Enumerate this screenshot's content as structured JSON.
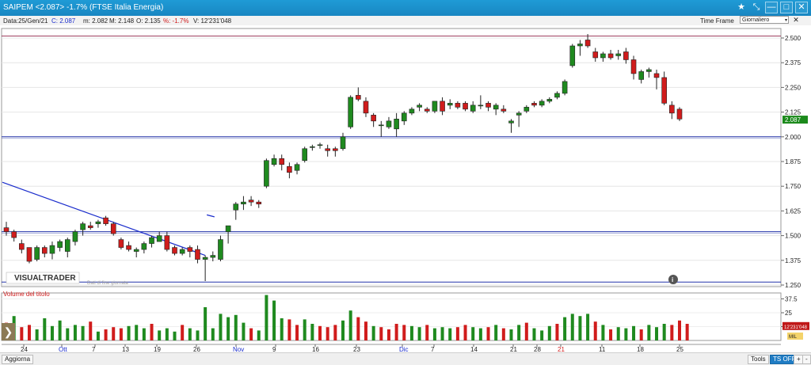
{
  "window": {
    "title": "SAIPEM <2.087> -1.7%  (FTSE Italia Energia)",
    "buttons": [
      "★",
      "⤡",
      "—",
      "□",
      "✕"
    ]
  },
  "info": {
    "data": "Data:25/Gen/21",
    "close": "C: 2.087",
    "min": "m: 2.082",
    "max": "M: 2.148",
    "open": "O: 2.135",
    "pct": "%: -1.7%",
    "vol": "V: 12'231'048",
    "timeframe_label": "Time Frame",
    "timeframe_value": "Giornaliero",
    "timeframe_arrow": "▾",
    "close_x": "✕"
  },
  "logo": {
    "text": "VISUALTRADER",
    "caption": "Dati di fine giornata"
  },
  "volume_title": "Volume del titolo",
  "info_icon": "i",
  "bottom": {
    "left": "Aggiorna",
    "tools": "Tools",
    "tsoff": "TS OFF",
    "plus": "+",
    "minus": "-"
  },
  "side_arrow": "❯",
  "colors": {
    "up": "#1f8a1f",
    "down": "#d01c1c",
    "line": "#1a2ccc",
    "hline": "#2233aa",
    "hline_top": "#a04060"
  },
  "chart_data": [
    {
      "type": "candlestick",
      "ylim": [
        1.25,
        2.5
      ],
      "yticks": [
        "2.500",
        "2.375",
        "2.250",
        "2.125",
        "2.000",
        "1.875",
        "1.750",
        "1.625",
        "1.500",
        "1.375",
        "1.250"
      ],
      "current_label": "2.087",
      "xlabels": [
        "24",
        "Ott",
        "7",
        "13",
        "19",
        "26",
        "Nov",
        "9",
        "16",
        "23",
        "Dic",
        "7",
        "14",
        "21",
        "28",
        "21",
        "11",
        "18",
        "25"
      ],
      "highlight_xlabel": "21",
      "hlines": [
        2.51,
        2.0,
        1.52,
        1.265
      ],
      "ohlc": [
        [
          1.54,
          1.57,
          1.5,
          1.52
        ],
        [
          1.52,
          1.53,
          1.47,
          1.49
        ],
        [
          1.46,
          1.48,
          1.41,
          1.43
        ],
        [
          1.44,
          1.44,
          1.36,
          1.37
        ],
        [
          1.38,
          1.45,
          1.37,
          1.44
        ],
        [
          1.44,
          1.45,
          1.39,
          1.41
        ],
        [
          1.41,
          1.47,
          1.38,
          1.45
        ],
        [
          1.44,
          1.48,
          1.42,
          1.47
        ],
        [
          1.42,
          1.49,
          1.39,
          1.48
        ],
        [
          1.47,
          1.53,
          1.45,
          1.52
        ],
        [
          1.53,
          1.57,
          1.5,
          1.56
        ],
        [
          1.55,
          1.57,
          1.53,
          1.54
        ],
        [
          1.56,
          1.58,
          1.54,
          1.57
        ],
        [
          1.59,
          1.6,
          1.55,
          1.56
        ],
        [
          1.56,
          1.57,
          1.5,
          1.51
        ],
        [
          1.48,
          1.49,
          1.43,
          1.44
        ],
        [
          1.45,
          1.47,
          1.42,
          1.43
        ],
        [
          1.42,
          1.44,
          1.39,
          1.43
        ],
        [
          1.43,
          1.47,
          1.41,
          1.46
        ],
        [
          1.46,
          1.5,
          1.44,
          1.49
        ],
        [
          1.47,
          1.52,
          1.47,
          1.5
        ],
        [
          1.5,
          1.52,
          1.42,
          1.43
        ],
        [
          1.44,
          1.45,
          1.4,
          1.41
        ],
        [
          1.41,
          1.44,
          1.4,
          1.43
        ],
        [
          1.44,
          1.45,
          1.39,
          1.42
        ],
        [
          1.43,
          1.45,
          1.36,
          1.38
        ],
        [
          1.38,
          1.4,
          1.27,
          1.39
        ],
        [
          1.39,
          1.42,
          1.37,
          1.4
        ],
        [
          1.38,
          1.5,
          1.37,
          1.48
        ],
        [
          1.52,
          1.55,
          1.46,
          1.55
        ],
        [
          1.63,
          1.67,
          1.58,
          1.66
        ],
        [
          1.66,
          1.7,
          1.63,
          1.67
        ],
        [
          1.68,
          1.7,
          1.65,
          1.67
        ],
        [
          1.67,
          1.68,
          1.64,
          1.66
        ],
        [
          1.75,
          1.89,
          1.74,
          1.88
        ],
        [
          1.86,
          1.91,
          1.85,
          1.89
        ],
        [
          1.89,
          1.91,
          1.83,
          1.86
        ],
        [
          1.85,
          1.87,
          1.79,
          1.82
        ],
        [
          1.83,
          1.87,
          1.81,
          1.86
        ],
        [
          1.88,
          1.95,
          1.87,
          1.94
        ],
        [
          1.95,
          1.96,
          1.93,
          1.95
        ],
        [
          1.96,
          1.97,
          1.94,
          1.96
        ],
        [
          1.94,
          1.96,
          1.9,
          1.93
        ],
        [
          1.94,
          1.95,
          1.9,
          1.93
        ],
        [
          1.94,
          2.02,
          1.93,
          2.0
        ],
        [
          2.05,
          2.21,
          2.04,
          2.2
        ],
        [
          2.21,
          2.25,
          2.18,
          2.19
        ],
        [
          2.18,
          2.2,
          2.1,
          2.12
        ],
        [
          2.11,
          2.12,
          2.05,
          2.08
        ],
        [
          2.06,
          2.08,
          2.0,
          2.06
        ],
        [
          2.05,
          2.1,
          2.04,
          2.08
        ],
        [
          2.04,
          2.12,
          2.0,
          2.09
        ],
        [
          2.08,
          2.13,
          2.06,
          2.12
        ],
        [
          2.12,
          2.15,
          2.11,
          2.14
        ],
        [
          2.15,
          2.17,
          2.13,
          2.16
        ],
        [
          2.14,
          2.15,
          2.12,
          2.13
        ],
        [
          2.13,
          2.18,
          2.12,
          2.18
        ],
        [
          2.18,
          2.2,
          2.11,
          2.13
        ],
        [
          2.16,
          2.19,
          2.14,
          2.17
        ],
        [
          2.17,
          2.18,
          2.14,
          2.15
        ],
        [
          2.17,
          2.18,
          2.13,
          2.14
        ],
        [
          2.13,
          2.18,
          2.12,
          2.16
        ],
        [
          2.16,
          2.21,
          2.14,
          2.16
        ],
        [
          2.17,
          2.18,
          2.13,
          2.15
        ],
        [
          2.14,
          2.17,
          2.11,
          2.16
        ],
        [
          2.14,
          2.16,
          2.12,
          2.13
        ],
        [
          2.07,
          2.09,
          2.02,
          2.08
        ],
        [
          2.11,
          2.13,
          2.05,
          2.12
        ],
        [
          2.13,
          2.16,
          2.12,
          2.15
        ],
        [
          2.17,
          2.18,
          2.15,
          2.16
        ],
        [
          2.16,
          2.19,
          2.15,
          2.18
        ],
        [
          2.18,
          2.2,
          2.17,
          2.19
        ],
        [
          2.2,
          2.23,
          2.19,
          2.22
        ],
        [
          2.22,
          2.29,
          2.21,
          2.28
        ],
        [
          2.36,
          2.47,
          2.35,
          2.46
        ],
        [
          2.46,
          2.49,
          2.41,
          2.47
        ],
        [
          2.49,
          2.52,
          2.45,
          2.46
        ],
        [
          2.43,
          2.45,
          2.38,
          2.4
        ],
        [
          2.4,
          2.43,
          2.38,
          2.42
        ],
        [
          2.42,
          2.44,
          2.39,
          2.4
        ],
        [
          2.41,
          2.44,
          2.39,
          2.42
        ],
        [
          2.43,
          2.45,
          2.37,
          2.39
        ],
        [
          2.39,
          2.41,
          2.29,
          2.32
        ],
        [
          2.29,
          2.34,
          2.27,
          2.33
        ],
        [
          2.33,
          2.35,
          2.3,
          2.34
        ],
        [
          2.32,
          2.34,
          2.24,
          2.3
        ],
        [
          2.3,
          2.33,
          2.16,
          2.17
        ],
        [
          2.16,
          2.18,
          2.09,
          2.12
        ],
        [
          2.14,
          2.15,
          2.08,
          2.09
        ]
      ],
      "volume": {
        "yticks": [
          "37.5",
          "25",
          "12.5"
        ],
        "ylim": [
          0,
          40
        ],
        "current_label": "12'231'048",
        "side_label": "MIL",
        "values": [
          [
            16,
            0
          ],
          [
            22,
            1
          ],
          [
            12,
            0
          ],
          [
            14,
            0
          ],
          [
            10,
            1
          ],
          [
            20,
            1
          ],
          [
            13,
            1
          ],
          [
            18,
            1
          ],
          [
            11,
            1
          ],
          [
            14,
            1
          ],
          [
            13,
            1
          ],
          [
            17,
            0
          ],
          [
            8,
            1
          ],
          [
            10,
            0
          ],
          [
            12,
            0
          ],
          [
            11,
            0
          ],
          [
            13,
            1
          ],
          [
            14,
            1
          ],
          [
            11,
            1
          ],
          [
            15,
            0
          ],
          [
            9,
            1
          ],
          [
            11,
            1
          ],
          [
            8,
            1
          ],
          [
            14,
            0
          ],
          [
            11,
            1
          ],
          [
            9,
            1
          ],
          [
            30,
            1
          ],
          [
            11,
            1
          ],
          [
            24,
            1
          ],
          [
            21,
            1
          ],
          [
            23,
            1
          ],
          [
            16,
            1
          ],
          [
            11,
            0
          ],
          [
            9,
            1
          ],
          [
            41,
            1
          ],
          [
            36,
            1
          ],
          [
            20,
            1
          ],
          [
            19,
            0
          ],
          [
            14,
            0
          ],
          [
            19,
            1
          ],
          [
            15,
            1
          ],
          [
            13,
            0
          ],
          [
            12,
            0
          ],
          [
            14,
            0
          ],
          [
            18,
            1
          ],
          [
            27,
            1
          ],
          [
            21,
            0
          ],
          [
            17,
            0
          ],
          [
            13,
            1
          ],
          [
            12,
            0
          ],
          [
            10,
            0
          ],
          [
            15,
            0
          ],
          [
            14,
            0
          ],
          [
            13,
            1
          ],
          [
            12,
            1
          ],
          [
            14,
            0
          ],
          [
            11,
            1
          ],
          [
            12,
            1
          ],
          [
            11,
            1
          ],
          [
            12,
            0
          ],
          [
            14,
            0
          ],
          [
            12,
            1
          ],
          [
            11,
            1
          ],
          [
            12,
            0
          ],
          [
            14,
            1
          ],
          [
            11,
            0
          ],
          [
            10,
            1
          ],
          [
            14,
            1
          ],
          [
            16,
            0
          ],
          [
            11,
            1
          ],
          [
            9,
            1
          ],
          [
            13,
            1
          ],
          [
            15,
            0
          ],
          [
            21,
            1
          ],
          [
            24,
            1
          ],
          [
            22,
            1
          ],
          [
            24,
            1
          ],
          [
            17,
            0
          ],
          [
            14,
            1
          ],
          [
            10,
            0
          ],
          [
            12,
            1
          ],
          [
            11,
            1
          ],
          [
            13,
            1
          ],
          [
            10,
            0
          ],
          [
            14,
            1
          ],
          [
            12,
            1
          ],
          [
            15,
            1
          ],
          [
            14,
            0
          ],
          [
            18,
            0
          ],
          [
            15,
            0
          ]
        ]
      }
    }
  ]
}
